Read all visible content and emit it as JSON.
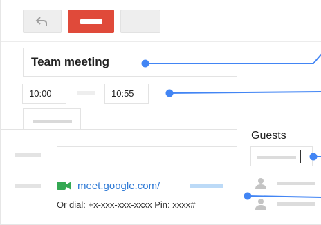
{
  "event": {
    "title": "Team meeting",
    "start_time": "10:00",
    "end_time": "10:55"
  },
  "guests": {
    "heading": "Guests"
  },
  "conference": {
    "link_text": "meet.google.com/",
    "dial_text": "Or dial: +x-xxx-xxx-xxxx  Pin: xxxx#"
  },
  "colors": {
    "accent": "#4285f4",
    "delete": "#e04a3a",
    "meet_green": "#34a853"
  },
  "icons": [
    "back-icon",
    "delete-icon",
    "video-camera-icon",
    "person-icon"
  ]
}
